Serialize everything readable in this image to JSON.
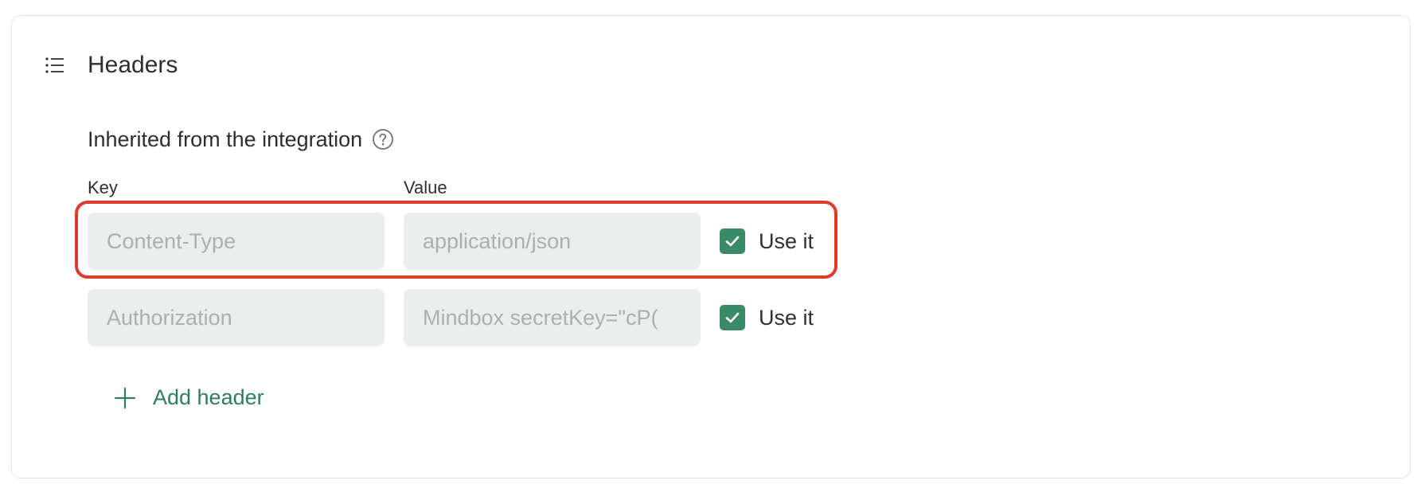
{
  "section": {
    "title": "Headers",
    "icon": "list-icon"
  },
  "inherited": {
    "heading": "Inherited from the integration",
    "help_icon": "help-circle-icon"
  },
  "columns": {
    "key": "Key",
    "value": "Value"
  },
  "rows": [
    {
      "key": "Content-Type",
      "value": "application/json",
      "use_label": "Use it",
      "use_checked": true
    },
    {
      "key": "Authorization",
      "value": "Mindbox secretKey=\"cP(",
      "use_label": "Use it",
      "use_checked": true
    }
  ],
  "add_header": {
    "label": "Add header",
    "icon": "plus-icon"
  },
  "colors": {
    "accent": "#2f7d5d",
    "checkbox": "#3a8a6a",
    "highlight": "#e03a2a",
    "field_bg": "#eceeee"
  }
}
